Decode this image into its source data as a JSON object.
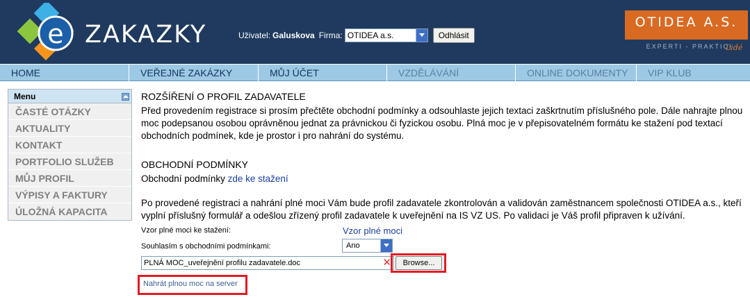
{
  "brand": {
    "logo_text": "ZAKAZKY",
    "partner_name": "OTIDEA A.S.",
    "partner_tagline": "EXPERTI - PRAKTICI -",
    "partner_tagline_end": "Lidé"
  },
  "userbar": {
    "user_label": "Uživatel:",
    "user_name": "Galuskova",
    "firm_label": "Firma:",
    "firm_value": "OTIDEA a.s.",
    "logout_label": "Odhlásit"
  },
  "nav": [
    {
      "label": "HOME"
    },
    {
      "label": "VEŘEJNÉ ZAKÁZKY"
    },
    {
      "label": "MŮJ ÚČET"
    },
    {
      "label": "VZDĚLÁVÁNÍ"
    },
    {
      "label": "ONLINE DOKUMENTY"
    },
    {
      "label": "VIP KLUB"
    }
  ],
  "sidebar": {
    "title": "Menu",
    "items": [
      {
        "label": "ČASTÉ OTÁZKY"
      },
      {
        "label": "AKTUALITY"
      },
      {
        "label": "KONTAKT"
      },
      {
        "label": "PORTFOLIO SLUŽEB"
      },
      {
        "label": "MŮJ PROFIL"
      },
      {
        "label": "VÝPISY A FAKTURY"
      },
      {
        "label": "ÚLOŽNÁ KAPACITA"
      }
    ]
  },
  "content": {
    "heading": "ROZŠÍŘENÍ O PROFIL ZADAVATELE",
    "intro": "Před provedením registrace si prosím přečtěte obchodní podmínky a odsouhlaste jejich textaci zaškrtnutím příslušného pole. Dále nahrajte plnou moc podepsanou osobou oprávněnou jednat za právnickou či fyzickou osobu. Plná moc je v přepisovatelném formátu ke stažení pod textací obchodních podmínek, kde je prostor i pro nahrání do systému.",
    "terms_heading": "OBCHODNÍ PODMÍNKY",
    "terms_text": "Obchodní podmínky",
    "terms_link": "zde ke stažení",
    "validation_text": "Po provedené registraci a nahrání plné moci Vám bude profil zadavatele zkontrolován a validován zaměstnancem společnosti OTIDEA a.s., kteří vyplní příslušný formulář a odešlou zřízený profil zadavatele k uveřejnění na IS VZ US. Po validaci je Váš profil připraven k užívání."
  },
  "form": {
    "template_label": "Vzor plné moci ke stažení:",
    "template_link": "Vzor plné moci",
    "agree_label": "Souhlasím s obchodními podmínkami:",
    "agree_value": "Ano",
    "file_value": "PLNÁ MOC_uveřejnění profilu zadavatele.doc",
    "browse_label": "Browse...",
    "upload_link": "Nahrát plnou moc na server"
  },
  "colors": {
    "header_bg": "#1f3a5e",
    "nav_bg": "#9dc9e4",
    "partner_orange": "#d96a22",
    "highlight_red": "#e31b23",
    "link_blue": "#1a3fa8"
  },
  "icons": [
    "e-logo-icon",
    "dropdown-arrow-icon",
    "collapse-icon",
    "clear-x-icon"
  ]
}
